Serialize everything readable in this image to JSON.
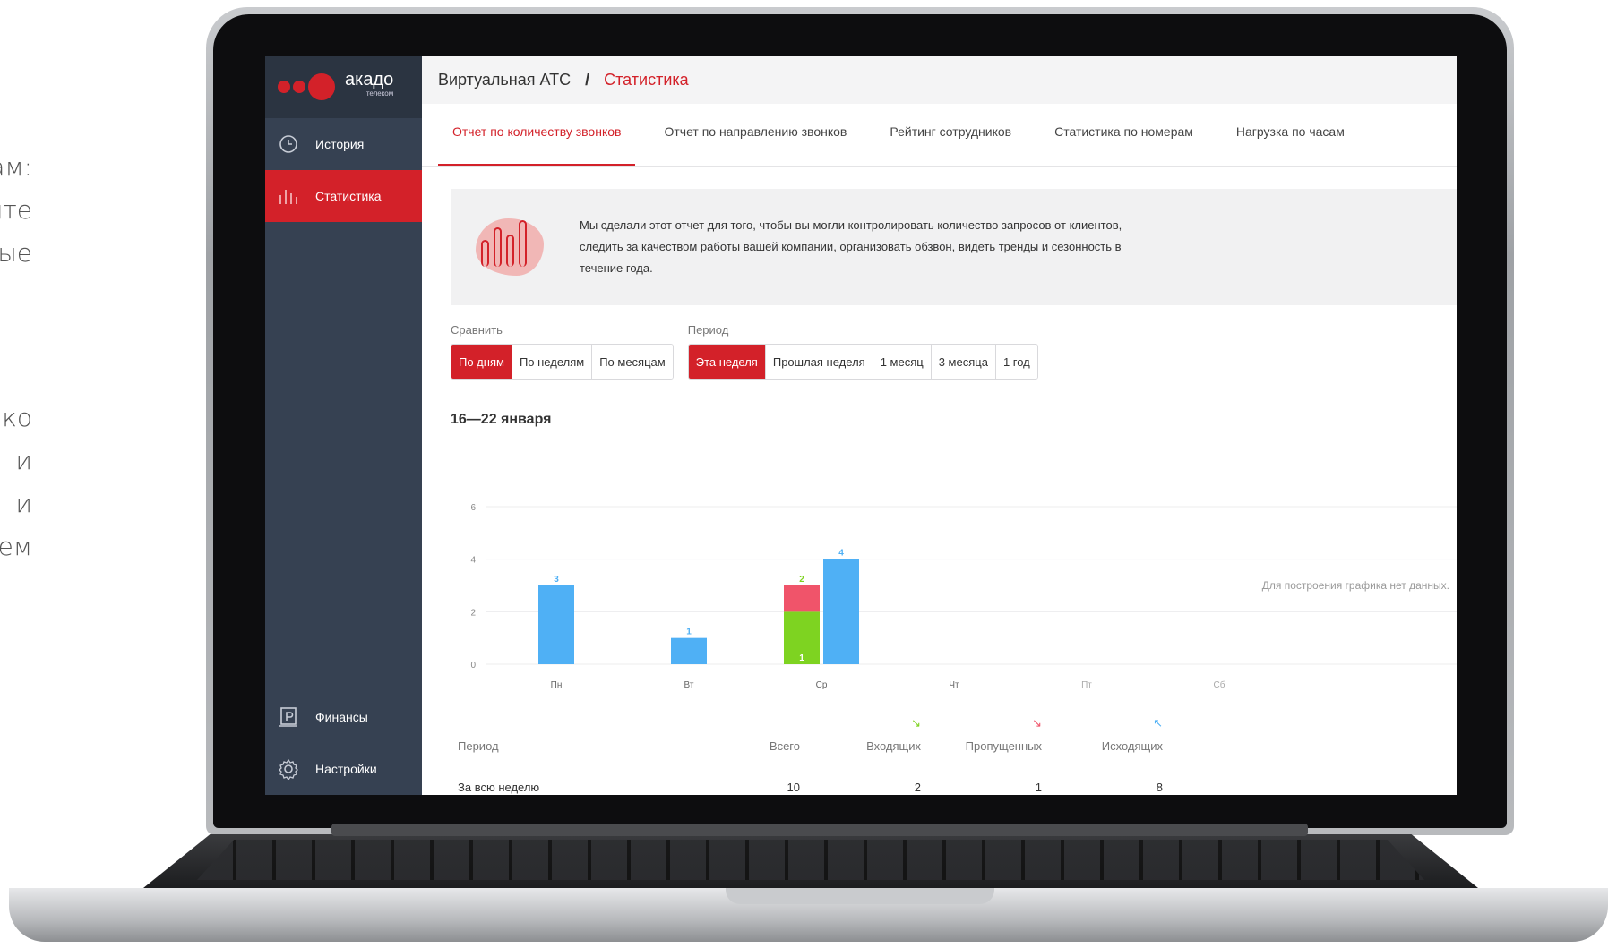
{
  "side_text": [
    "ам:",
    "ите",
    "ые",
    "ко",
    "и",
    "и",
    "ем"
  ],
  "logo": {
    "name": "акадо",
    "sub": "телеком"
  },
  "sidebar": {
    "items": [
      {
        "label": "История",
        "icon": "clock-icon"
      },
      {
        "label": "Статистика",
        "icon": "bar-chart-icon",
        "active": true
      }
    ],
    "bottom": [
      {
        "label": "Финансы",
        "icon": "wallet-icon"
      },
      {
        "label": "Настройки",
        "icon": "gear-icon"
      }
    ]
  },
  "breadcrumb": {
    "parent": "Виртуальная АТС",
    "separator": "/",
    "current": "Статистика"
  },
  "tabs": [
    {
      "label": "Отчет по количеству звонков",
      "active": true
    },
    {
      "label": "Отчет по направлению звонков"
    },
    {
      "label": "Рейтинг сотрудников"
    },
    {
      "label": "Статистика по номерам"
    },
    {
      "label": "Нагрузка по часам"
    }
  ],
  "info": {
    "text": "Мы сделали этот отчет для того, чтобы вы могли контролировать количество запросов от клиентов, следить за качеством работы вашей компании, организовать обзвон, видеть тренды и сезонность в течение года."
  },
  "compare": {
    "label": "Сравнить",
    "options": [
      "По дням",
      "По неделям",
      "По месяцам"
    ],
    "selected": "По дням"
  },
  "period": {
    "label": "Период",
    "options": [
      "Эта неделя",
      "Прошлая неделя",
      "1 месяц",
      "3 месяца",
      "1 год"
    ],
    "selected": "Эта неделя"
  },
  "period_title": "16—22 января",
  "chart_data": {
    "type": "bar",
    "categories": [
      "Пн",
      "Вт",
      "Ср",
      "Чт",
      "Пт",
      "Сб"
    ],
    "ylim": [
      0,
      6
    ],
    "yticks": [
      0,
      2,
      4,
      6
    ],
    "series": [
      {
        "name": "Входящих",
        "color": "#7ed321",
        "values": [
          0,
          0,
          2,
          0,
          0,
          0
        ],
        "stack": "in"
      },
      {
        "name": "Пропущенных",
        "color": "#f0546a",
        "values": [
          0,
          0,
          1,
          0,
          0,
          0
        ],
        "stack": "in"
      },
      {
        "name": "Исходящих",
        "color": "#4fb0f5",
        "values": [
          3,
          1,
          4,
          0,
          0,
          0
        ],
        "stack": "out"
      }
    ],
    "data_labels": [
      {
        "category": "Пн",
        "text": "3",
        "color": "#4fb0f5"
      },
      {
        "category": "Вт",
        "text": "1",
        "color": "#4fb0f5"
      },
      {
        "category": "Ср",
        "text": "2",
        "color": "#7ed321"
      },
      {
        "category": "Ср",
        "text": "1",
        "color": "#ffffff"
      },
      {
        "category": "Ср",
        "text": "4",
        "color": "#4fb0f5"
      }
    ],
    "empty_note": "Для построения графика нет данных."
  },
  "table": {
    "headers": [
      "Период",
      "Всего",
      "Входящих",
      "Пропущенных",
      "Исходящих"
    ],
    "rows": [
      [
        "За всю неделю",
        "10",
        "2",
        "1",
        "8"
      ]
    ],
    "header_icons": [
      {
        "name": "incoming-call-icon",
        "color": "#7ed321",
        "glyph": "↘"
      },
      {
        "name": "missed-call-icon",
        "color": "#f0546a",
        "glyph": "↘"
      },
      {
        "name": "outgoing-call-icon",
        "color": "#4fb0f5",
        "glyph": "↖"
      }
    ]
  }
}
